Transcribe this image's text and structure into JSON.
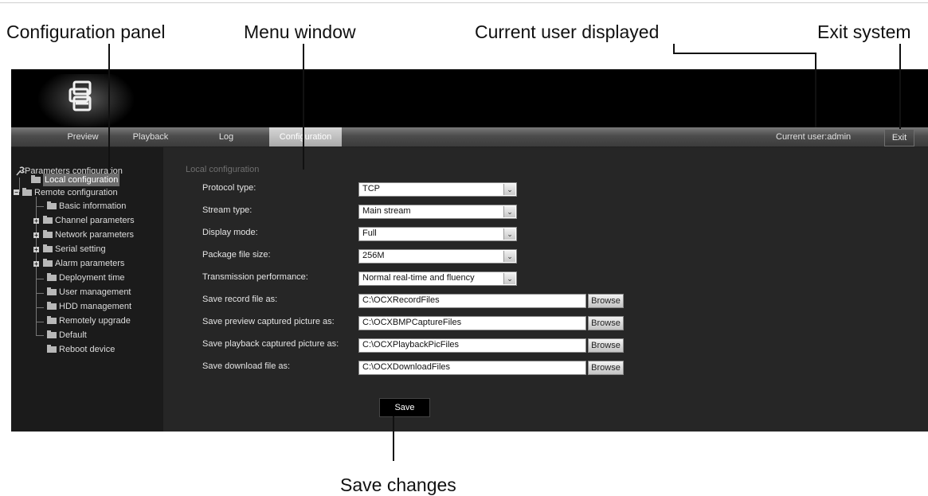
{
  "callouts": {
    "configuration_panel": "Configuration panel",
    "menu_window": "Menu window",
    "current_user_displayed": "Current user displayed",
    "exit_system": "Exit system",
    "save_changes": "Save changes"
  },
  "menubar": {
    "tabs": [
      {
        "label": "Preview"
      },
      {
        "label": "Playback"
      },
      {
        "label": "Log"
      },
      {
        "label": "Configuration",
        "active": true
      }
    ],
    "current_user": "Current user:admin",
    "exit_label": "Exit"
  },
  "sidebar": {
    "root_label": "Parameters configuration",
    "items": [
      {
        "label": "Local configuration",
        "selected": true
      },
      {
        "label": "Remote configuration",
        "expanded": true
      },
      {
        "label": "Basic information"
      },
      {
        "label": "Channel parameters",
        "expandable": true
      },
      {
        "label": "Network parameters",
        "expandable": true
      },
      {
        "label": "Serial setting",
        "expandable": true
      },
      {
        "label": "Alarm parameters",
        "expandable": true
      },
      {
        "label": "Deployment time"
      },
      {
        "label": "User management"
      },
      {
        "label": "HDD management"
      },
      {
        "label": "Remotely upgrade"
      },
      {
        "label": "Default"
      },
      {
        "label": "Reboot device"
      }
    ]
  },
  "content": {
    "section_title": "Local configuration",
    "fields": [
      {
        "label": "Protocol type:",
        "value": "TCP"
      },
      {
        "label": "Stream type:",
        "value": "Main stream"
      },
      {
        "label": "Display mode:",
        "value": "Full"
      },
      {
        "label": "Package file size:",
        "value": "256M"
      },
      {
        "label": "Transmission performance:",
        "value": "Normal real-time and fluency"
      },
      {
        "label": "Save record file as:",
        "value": "C:\\OCXRecordFiles"
      },
      {
        "label": "Save preview captured picture as:",
        "value": "C:\\OCXBMPCaptureFiles"
      },
      {
        "label": "Save playback captured picture as:",
        "value": "C:\\OCXPlaybackPicFiles"
      },
      {
        "label": "Save download file as:",
        "value": "C:\\OCXDownloadFiles"
      }
    ],
    "browse_label": "Browse",
    "save_label": "Save"
  },
  "colors": {
    "header": "#000000",
    "panel": "#262626",
    "sidebar": "#1b1b1b",
    "active_tab": "#b8b8b8"
  }
}
